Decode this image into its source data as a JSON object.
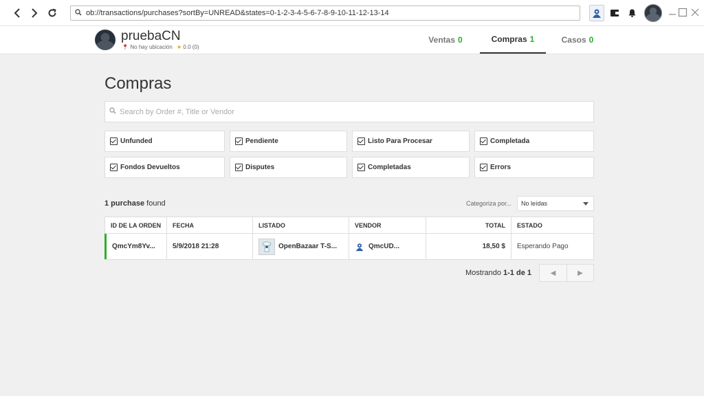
{
  "browser": {
    "url": "ob://transactions/purchases?sortBy=UNREAD&states=0-1-2-3-4-5-6-7-8-9-10-11-12-13-14"
  },
  "profile": {
    "name": "pruebaCN",
    "location": "No hay ubicación",
    "rating": "0.0 (0)"
  },
  "tabs": [
    {
      "label": "Ventas",
      "count": "0"
    },
    {
      "label": "Compras",
      "count": "1"
    },
    {
      "label": "Casos",
      "count": "0"
    }
  ],
  "page": {
    "title": "Compras",
    "search_placeholder": "Search by Order #, Title or Vendor"
  },
  "filters": [
    "Unfunded",
    "Pendiente",
    "Listo Para Procesar",
    "Completada",
    "Fondos Devueltos",
    "Disputes",
    "Completadas",
    "Errors"
  ],
  "results": {
    "count": "1 purchase",
    "suffix": " found",
    "sort_label": "Categoriza por...",
    "sort_value": "No leídas"
  },
  "table": {
    "headers": [
      "ID DE LA ORDEN",
      "FECHA",
      "LISTADO",
      "VENDOR",
      "TOTAL",
      "ESTADO"
    ],
    "rows": [
      {
        "order_id": "QmcYm8Yv...",
        "date": "5/9/2018 21:28",
        "listing": "OpenBazaar T-S...",
        "vendor": "QmcUD...",
        "total": "18,50 $",
        "status": "Esperando Pago"
      }
    ]
  },
  "pagination": {
    "prefix": "Mostrando ",
    "range": "1-1 de 1"
  },
  "colors": {
    "accent_green": "#2bae2b",
    "background": "#f0f0f0"
  }
}
